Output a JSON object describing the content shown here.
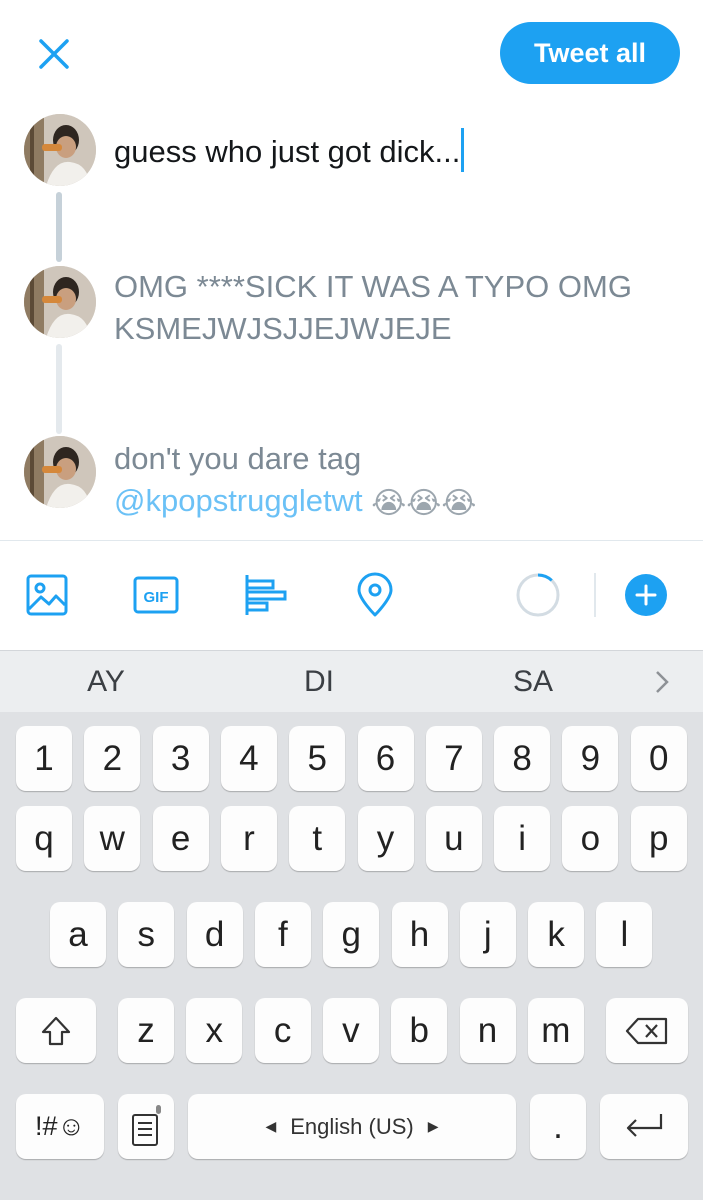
{
  "header": {
    "tweet_all_label": "Tweet all"
  },
  "thread": [
    {
      "text": "guess who just got dick...",
      "state": "active"
    },
    {
      "text_line1": "OMG ****SICK IT WAS A TYPO OMG",
      "text_line2": "KSMEJWJSJJEJWJEJE",
      "state": "inactive"
    },
    {
      "text_line1": "don't you dare tag",
      "mention": "@kpopstruggletwt",
      "emojis": "😭😭😭",
      "state": "inactive"
    }
  ],
  "toolbar": {
    "icons": [
      "image-icon",
      "gif-icon",
      "poll-icon",
      "location-icon",
      "character-count-ring",
      "add-tweet-icon"
    ],
    "gif_label": "GIF",
    "character_ring_progress": 0.12
  },
  "keyboard": {
    "suggestions": [
      "AY",
      "DI",
      "SA"
    ],
    "row_numbers": [
      "1",
      "2",
      "3",
      "4",
      "5",
      "6",
      "7",
      "8",
      "9",
      "0"
    ],
    "row_top": [
      "q",
      "w",
      "e",
      "r",
      "t",
      "y",
      "u",
      "i",
      "o",
      "p"
    ],
    "row_middle": [
      "a",
      "s",
      "d",
      "f",
      "g",
      "h",
      "j",
      "k",
      "l"
    ],
    "row_bottom": [
      "z",
      "x",
      "c",
      "v",
      "b",
      "n",
      "m"
    ],
    "symbols_label": "!#☺",
    "space_label": "English (US)",
    "period_label": "."
  },
  "colors": {
    "accent": "#1da1f2",
    "keyboard_bg": "#dfe1e4",
    "muted_text": "#7c8994"
  }
}
